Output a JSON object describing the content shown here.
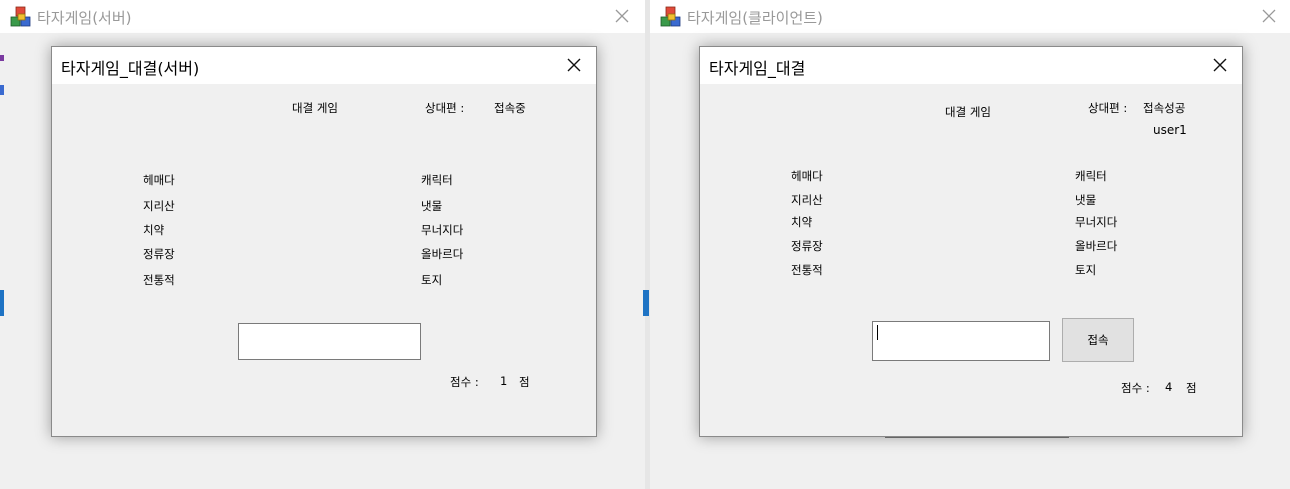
{
  "server_window": {
    "title": "타자게임(서버)",
    "dialog": {
      "title": "타자게임_대결(서버)",
      "heading": "대결 게임",
      "opponent_label": "상대편 :",
      "opponent_status": "접속중",
      "words_left": [
        "헤매다",
        "지리산",
        "치약",
        "정류장",
        "전통적"
      ],
      "words_right": [
        "캐릭터",
        "냇물",
        "무너지다",
        "올바르다",
        "토지"
      ],
      "input_value": "",
      "score_label": "점수 :",
      "score_value": "1",
      "score_unit": "점"
    }
  },
  "client_window": {
    "title": "타자게임(클라이언트)",
    "dialog": {
      "title": "타자게임_대결",
      "heading": "대결 게임",
      "opponent_label": "상대편 :",
      "opponent_status": "접속성공",
      "opponent_name": "user1",
      "words_left": [
        "헤매다",
        "지리산",
        "치약",
        "정류장",
        "전통적"
      ],
      "words_right": [
        "캐릭터",
        "냇물",
        "무너지다",
        "올바르다",
        "토지"
      ],
      "input_value": "",
      "connect_button": "접속",
      "score_label": "점수 :",
      "score_value": "4",
      "score_unit": "점"
    }
  },
  "colors": {
    "window_bg": "#f0f0f0",
    "titlebar_bg": "#ffffff",
    "inactive_title": "#999999",
    "accent_blue": "#1e73c4"
  }
}
